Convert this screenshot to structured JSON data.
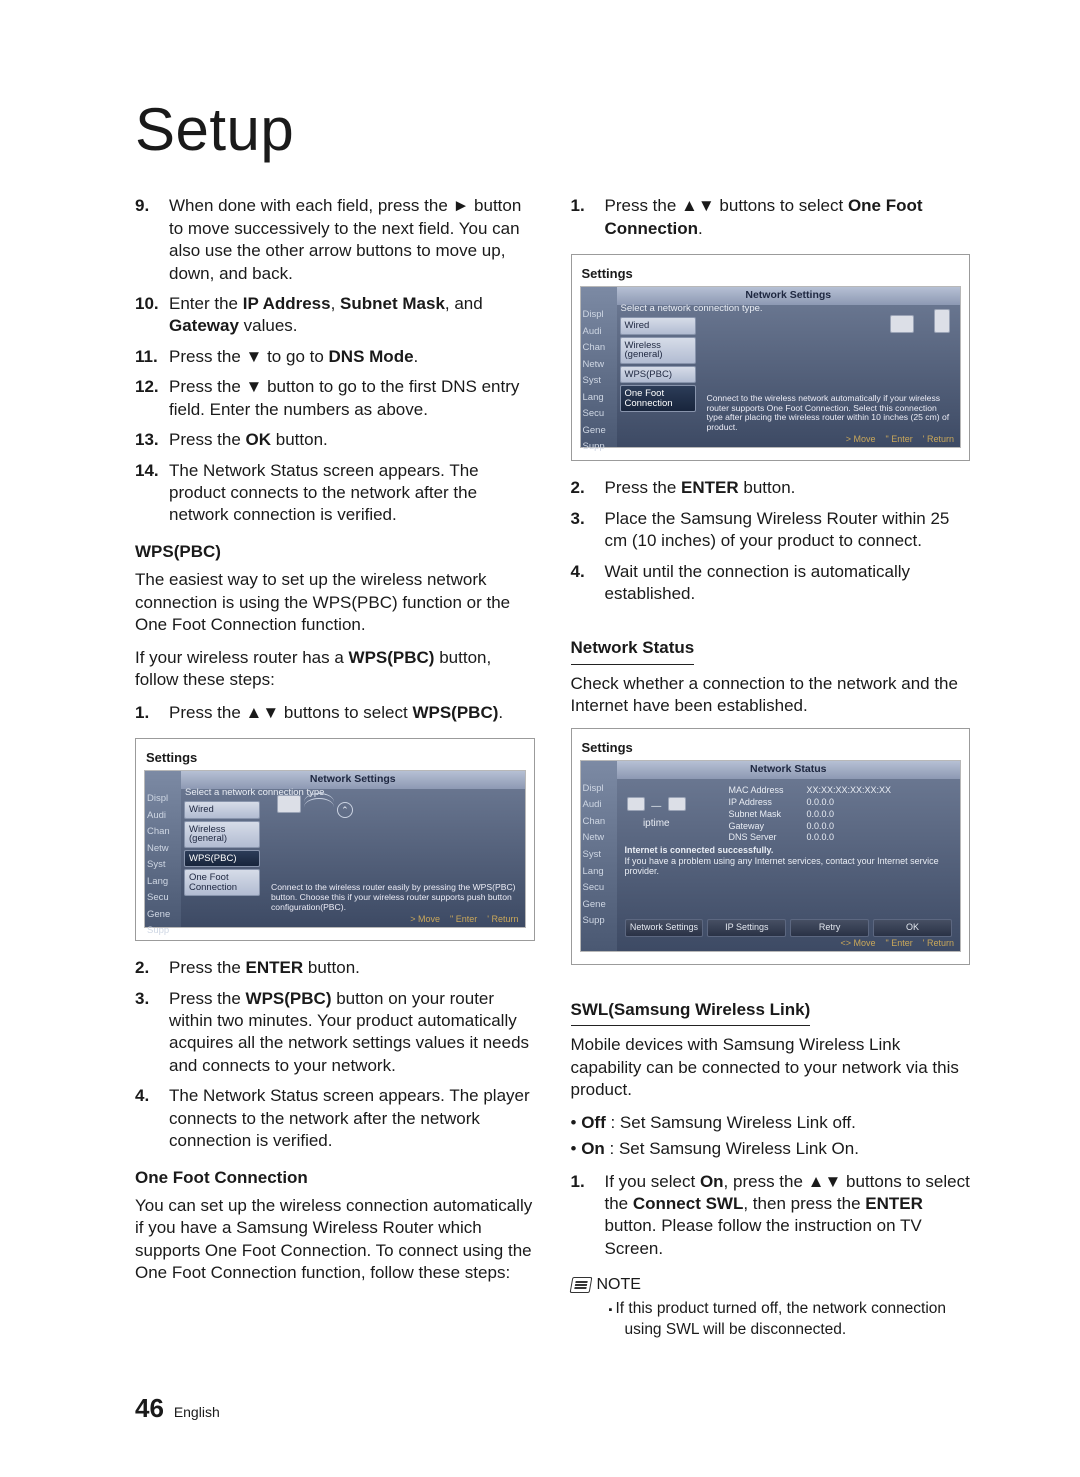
{
  "title": "Setup",
  "left": {
    "steps1": [
      {
        "n": "9.",
        "html": "When done with each field, press the ► button to move successively to the next field. You can also use the other arrow buttons to move up, down, and back."
      },
      {
        "n": "10.",
        "html": "Enter the <b>IP Address</b>, <b>Subnet Mask</b>, and <b>Gateway</b> values."
      },
      {
        "n": "11.",
        "html": "Press the ▼ to go to <b>DNS Mode</b>."
      },
      {
        "n": "12.",
        "html": "Press the ▼ button to go to the first DNS entry field. Enter the numbers as above."
      },
      {
        "n": "13.",
        "html": "Press the <b>OK</b> button."
      },
      {
        "n": "14.",
        "html": "The Network Status screen appears. The product connects to the network after the network connection is verified."
      }
    ],
    "wps_h": "WPS(PBC)",
    "wps_p1": "The easiest way to set up the wireless network connection is using the WPS(PBC) function or the One Foot Connection function.",
    "wps_p2": "If your wireless router has a <b>WPS(PBC)</b> button, follow these steps:",
    "wps_steps_pre": [
      {
        "n": "1.",
        "html": "Press the ▲▼ buttons to select <b>WPS(PBC)</b>."
      }
    ],
    "osd1": {
      "title": "Settings",
      "subtitle": "Network Settings",
      "prompt": "Select a network connection type.",
      "sidebar": [
        "Displ",
        "Audi",
        "Chan",
        "Netw",
        "Syst",
        "Lang",
        "Secu",
        "Gene",
        "Supp"
      ],
      "menu": [
        {
          "label": "Wired",
          "hl": false
        },
        {
          "label": "Wireless (general)",
          "hl": false
        },
        {
          "label": "WPS(PBC)",
          "hl": true
        },
        {
          "label": "One Foot Connection",
          "hl": false
        }
      ],
      "help": "Connect to the wireless router easily by pressing the WPS(PBC) button. Choose this if your wireless router supports push button configuration(PBC).",
      "footer": [
        "> Move",
        "\" Enter",
        "' Return"
      ]
    },
    "wps_steps_post": [
      {
        "n": "2.",
        "html": "Press the <b>ENTER</b> button."
      },
      {
        "n": "3.",
        "html": "Press the <b>WPS(PBC)</b> button on your router within two minutes. Your product automatically acquires all the network settings values it needs and connects to your network."
      },
      {
        "n": "4.",
        "html": "The Network Status screen appears. The player connects to the network after the network connection is verified."
      }
    ],
    "ofc_h": "One Foot Connection",
    "ofc_p": "You can set up the wireless connection automatically if you have a Samsung Wireless Router which supports One Foot Connection. To connect using the One Foot Connection function, follow these steps:"
  },
  "right": {
    "steps1": [
      {
        "n": "1.",
        "html": "Press the ▲▼ buttons to select <b>One Foot Connection</b>."
      }
    ],
    "osd2": {
      "title": "Settings",
      "subtitle": "Network Settings",
      "prompt": "Select a network connection type.",
      "sidebar": [
        "Displ",
        "Audi",
        "Chan",
        "Netw",
        "Syst",
        "Lang",
        "Secu",
        "Gene",
        "Supp"
      ],
      "menu": [
        {
          "label": "Wired",
          "hl": false
        },
        {
          "label": "Wireless (general)",
          "hl": false
        },
        {
          "label": "WPS(PBC)",
          "hl": false
        },
        {
          "label": "One Foot Connection",
          "hl": true
        }
      ],
      "help": "Connect to the wireless network automatically if your wireless router supports One Foot Connection. Select this connection type after placing the wireless router within 10 inches (25 cm) of product.",
      "footer": [
        "> Move",
        "\" Enter",
        "' Return"
      ]
    },
    "steps2": [
      {
        "n": "2.",
        "html": "Press the <b>ENTER</b> button."
      },
      {
        "n": "3.",
        "html": "Place the Samsung Wireless Router within 25 cm (10 inches) of your product to connect."
      },
      {
        "n": "4.",
        "html": "Wait until the connection is automatically established."
      }
    ],
    "ns_h": "Network Status",
    "ns_p": "Check whether a connection to the network and the Internet have been established.",
    "osd3": {
      "title": "Settings",
      "subtitle": "Network Status",
      "sidebar": [
        "Displ",
        "Audi",
        "Chan",
        "Netw",
        "Syst",
        "Lang",
        "Secu",
        "Gene",
        "Supp"
      ],
      "ap": "iptime",
      "rows": [
        {
          "k": "MAC Address",
          "v": "XX:XX:XX:XX:XX:XX"
        },
        {
          "k": "IP Address",
          "v": "0.0.0.0"
        },
        {
          "k": "Subnet Mask",
          "v": "0.0.0.0"
        },
        {
          "k": "Gateway",
          "v": "0.0.0.0"
        },
        {
          "k": "DNS Server",
          "v": "0.0.0.0"
        }
      ],
      "msg1": "Internet is connected successfully.",
      "msg2": "If you have a problem using any Internet services, contact your Internet service provider.",
      "buttons": [
        "Network Settings",
        "IP Settings",
        "Retry",
        "OK"
      ],
      "footer": [
        "<> Move",
        "\" Enter",
        "' Return"
      ]
    },
    "swl_h": "SWL(Samsung Wireless Link)",
    "swl_p": "Mobile devices with Samsung Wireless Link capability can be connected to your network via this product.",
    "swl_bullets": [
      "<b>Off</b> : Set Samsung Wireless Link off.",
      "<b>On</b> : Set Samsung Wireless Link On."
    ],
    "swl_steps": [
      {
        "n": "1.",
        "html": "If you select <b>On</b>, press the ▲▼ buttons to select the <b>Connect SWL</b>, then press the <b>ENTER</b> button. Please follow the instruction on TV Screen."
      }
    ],
    "note_label": "NOTE",
    "notes": [
      "If this product turned off, the network connection using SWL will be disconnected."
    ]
  },
  "pagefoot": {
    "num": "46",
    "lang": "English"
  }
}
